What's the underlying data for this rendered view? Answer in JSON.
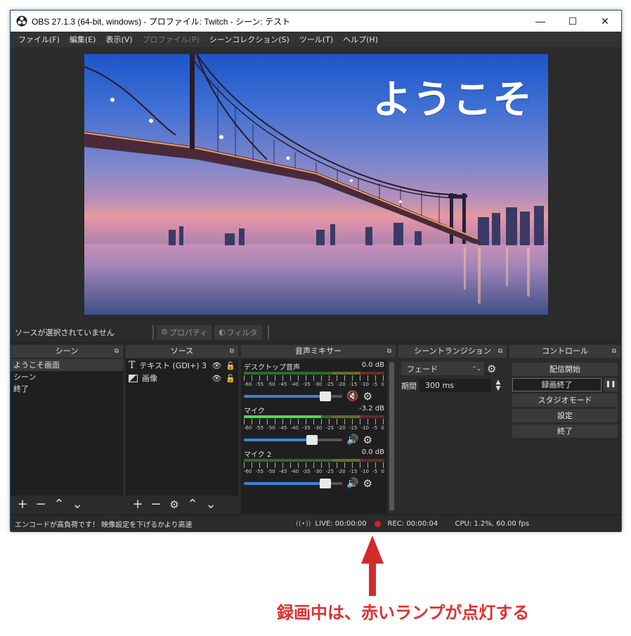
{
  "window": {
    "title": "OBS 27.1.3 (64-bit, windows) - プロファイル: Twitch - シーン: テスト",
    "minimize_label": "—",
    "maximize_label": "☐",
    "close_label": "✕"
  },
  "menu": [
    {
      "label": "ファイル(F)",
      "enabled": true
    },
    {
      "label": "編集(E)",
      "enabled": true
    },
    {
      "label": "表示(V)",
      "enabled": true
    },
    {
      "label": "プロファイル(P)",
      "enabled": false
    },
    {
      "label": "シーンコレクション(S)",
      "enabled": true
    },
    {
      "label": "ツール(T)",
      "enabled": true
    },
    {
      "label": "ヘルプ(H)",
      "enabled": true
    }
  ],
  "preview": {
    "overlay_text": "ようこそ"
  },
  "source_toolbar": {
    "no_selection": "ソースが選択されていません",
    "properties_label": "プロパティ",
    "filters_label": "フィルタ"
  },
  "scenes": {
    "title": "シーン",
    "items": [
      "ようこそ画面",
      "シーン",
      "終了"
    ],
    "selected_index": 0
  },
  "sources": {
    "title": "ソース",
    "items": [
      {
        "name": "テキスト (GDI+) 3",
        "icon": "text-icon"
      },
      {
        "name": "画像",
        "icon": "image-icon"
      }
    ]
  },
  "mixer": {
    "title": "音声ミキサー",
    "scale_labels": [
      "-60",
      "-55",
      "-50",
      "-45",
      "-40",
      "-35",
      "-30",
      "-25",
      "-20",
      "-15",
      "-10",
      "-5",
      "0"
    ],
    "channels": [
      {
        "name": "デスクトップ音声",
        "db": "0.0 dB",
        "level": 0,
        "volume": 0.86,
        "muted": true
      },
      {
        "name": "マイク",
        "db": "-3.2 dB",
        "level": 0.55,
        "volume": 0.72,
        "muted": false
      },
      {
        "name": "マイク 2",
        "db": "0.0 dB",
        "level": 0,
        "volume": 0.86,
        "muted": false
      }
    ]
  },
  "transitions": {
    "title": "シーントランジション",
    "type": "フェード",
    "duration_label": "期間",
    "duration_value": "300 ms"
  },
  "controls": {
    "title": "コントロール",
    "start_streaming": "配信開始",
    "stop_recording": "録画終了",
    "pause_label": "❚❚",
    "studio_mode": "スタジオモード",
    "settings": "設定",
    "exit": "終了"
  },
  "status": {
    "warning": "エンコードが高負荷です！ 映像設定を下げるかより高速",
    "live": "LIVE: 00:00:00",
    "rec": "REC: 00:00:04",
    "cpu": "CPU: 1.2%, 60.00 fps"
  },
  "colors": {
    "rec_dot": "#d42020",
    "annotation": "#e03030",
    "accent_blue": "#3a82d8"
  },
  "annotation": {
    "text": "録画中は、赤いランプが点灯する"
  }
}
